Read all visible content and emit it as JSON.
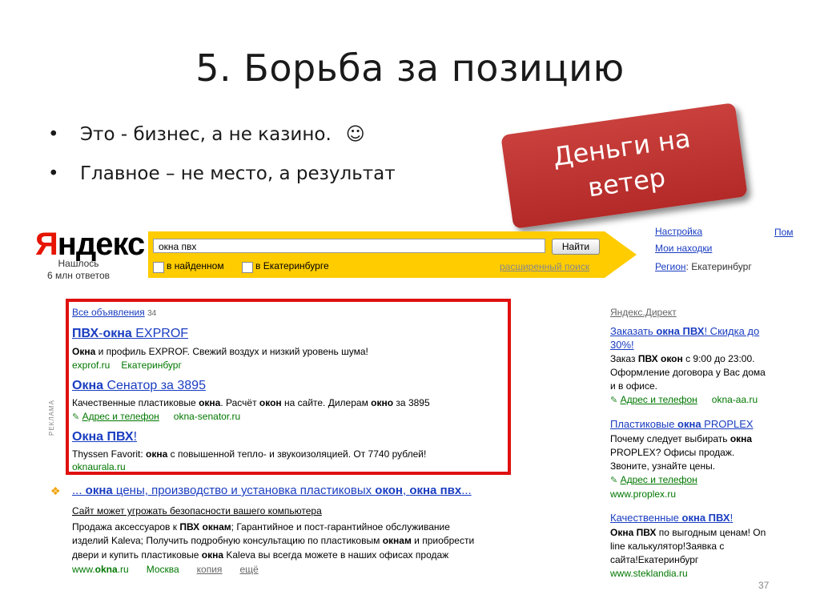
{
  "slide": {
    "title": "5. Борьба за позицию",
    "bullets": [
      "Это - бизнес, а не казино.",
      "Главное – не место, а результат"
    ],
    "smiley": "☺",
    "callout_line1": "Деньги на",
    "callout_line2": "ветер",
    "page_number": "37"
  },
  "yandex": {
    "logo_first": "Я",
    "logo_rest": "ндекс",
    "found_line1": "Нашлось",
    "found_line2": "6 млн ответов",
    "search_value": "окна пвх",
    "search_button": "Найти",
    "check_found": "в найденном",
    "check_city": "в Екатеринбурге",
    "advanced_search": "расширенный поиск",
    "settings": "Настройка",
    "my_finds": "Мои находки",
    "help": "Пом",
    "region_label": "Регион",
    "region_value": ": Екатеринбург"
  },
  "results": {
    "ads_label": "РЕКЛАМА",
    "all_ads": "Все объявления",
    "all_ads_count": "34",
    "ads": [
      {
        "title_a": "ПВХ",
        "title_b": "-",
        "title_c": "окна",
        "title_d": " EXPROF",
        "desc_a": "Окна",
        "desc_b": " и профиль EXPROF. Свежий воздух и низкий уровень шума!",
        "url": "exprof.ru",
        "city": "Екатеринбург"
      },
      {
        "title_a": "Окна",
        "title_b": " Сенатор за 3895",
        "desc_a": "Качественные пластиковые ",
        "desc_b": "окна",
        "desc_c": ". Расчёт ",
        "desc_d": "окон",
        "desc_e": " на сайте. Дилерам ",
        "desc_f": "окно",
        "desc_g": " за 3895",
        "address": "Адрес и телефон",
        "url": "okna-senator.ru"
      },
      {
        "title_a": "Окна ПВХ",
        "title_b": "!",
        "desc_a": "Thyssen Favorit: ",
        "desc_b": "окна",
        "desc_c": " с повышенной тепло- и звукоизоляцией. От 7740 рублей!",
        "url": "oknaurala.ru"
      }
    ],
    "organic": {
      "title_a": "... ",
      "title_b": "окна",
      "title_c": " цены, производство и установка пластиковых ",
      "title_d": "окон",
      "title_e": ", ",
      "title_f": "окна пвх",
      "title_g": "...",
      "warning": "Сайт может угрожать безопасности вашего компьютера",
      "line1_a": "Продажа аксессуаров к ",
      "line1_b": "ПВХ окнам",
      "line1_c": "; Гарантийное и пост-гарантийное обслуживание",
      "line2_a": "изделий Kaleva; Получить подробную консультацию по пластиковым ",
      "line2_b": "окнам",
      "line2_c": " и приобрести",
      "line3_a": "двери и купить пластиковые ",
      "line3_b": "окна",
      "line3_c": " Kaleva вы всегда можете в наших офисах продаж",
      "url_a": "www.",
      "url_b": "okna",
      "url_c": ".ru",
      "city": "Москва",
      "copy": "копия",
      "more": "ещё"
    }
  },
  "direct": {
    "header": "Яндекс.Директ",
    "ad1": {
      "t1": "Заказать ",
      "t2": "окна ПВХ",
      "t3": "! Скидка до",
      "t4": "30%!",
      "d1a": "Заказ ",
      "d1b": "ПВХ окон",
      "d1c": " с 9:00 до 23:00.",
      "d2": "Оформление договора у Вас дома",
      "d3": "и в офисе.",
      "address": "Адрес и телефон",
      "url": "okna-aa.ru"
    },
    "ad2": {
      "t1": "Пластиковые ",
      "t2": "окна",
      "t3": " PROPLEX",
      "d1a": "Почему следует выбирать ",
      "d1b": "окна",
      "d2": "PROPLEX? Офисы продаж.",
      "d3": "Звоните, узнайте цены.",
      "address": "Адрес и телефон",
      "url": "www.proplex.ru"
    },
    "ad3": {
      "t1": "Качественные ",
      "t2": "окна ПВХ",
      "t3": "!",
      "d1a": "Окна ПВХ",
      "d1b": " по выгодным ценам! On",
      "d2": "line калькулятор!Заявка с",
      "d3": "сайта!Екатеринбург",
      "url": "www.steklandia.ru"
    }
  },
  "colors": {
    "yandex_red": "#e61400",
    "search_yellow": "#ffcc00",
    "link_blue": "#1a3dc1",
    "url_green": "#007700",
    "highlight_red": "#e01010",
    "callout_red": "#c0392b"
  }
}
